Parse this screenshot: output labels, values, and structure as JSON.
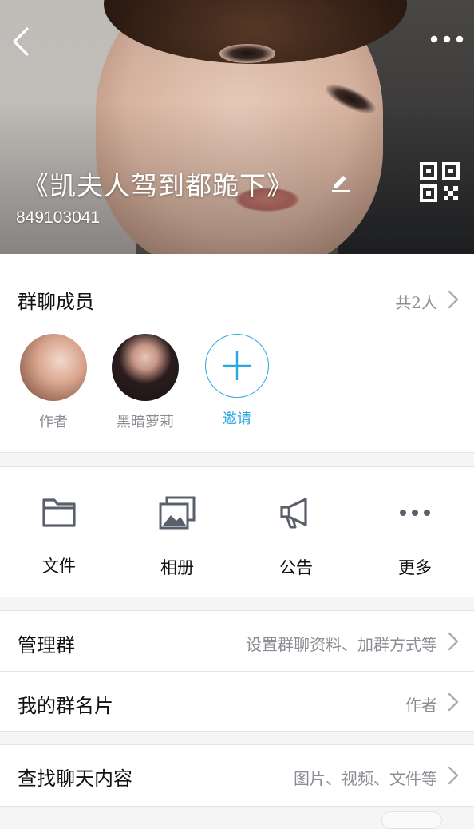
{
  "header": {
    "title": "《凯夫人驾到都跪下》",
    "group_id": "849103041"
  },
  "members": {
    "label": "群聊成员",
    "count_text": "共2人",
    "list": [
      {
        "name": "作者"
      },
      {
        "name": "黑暗萝莉"
      }
    ],
    "invite_label": "邀请"
  },
  "actions": [
    {
      "label": "文件",
      "icon": "folder-icon"
    },
    {
      "label": "相册",
      "icon": "album-icon"
    },
    {
      "label": "公告",
      "icon": "megaphone-icon"
    },
    {
      "label": "更多",
      "icon": "more-dots-icon"
    }
  ],
  "settings": {
    "manage": {
      "label": "管理群",
      "value": "设置群聊资料、加群方式等"
    },
    "card": {
      "label": "我的群名片",
      "value": "作者"
    }
  },
  "search": {
    "label": "查找聊天内容",
    "value": "图片、视频、文件等"
  },
  "colors": {
    "accent": "#29a8e0",
    "icon_gray": "#59606c",
    "secondary_text": "#8a8d93"
  }
}
